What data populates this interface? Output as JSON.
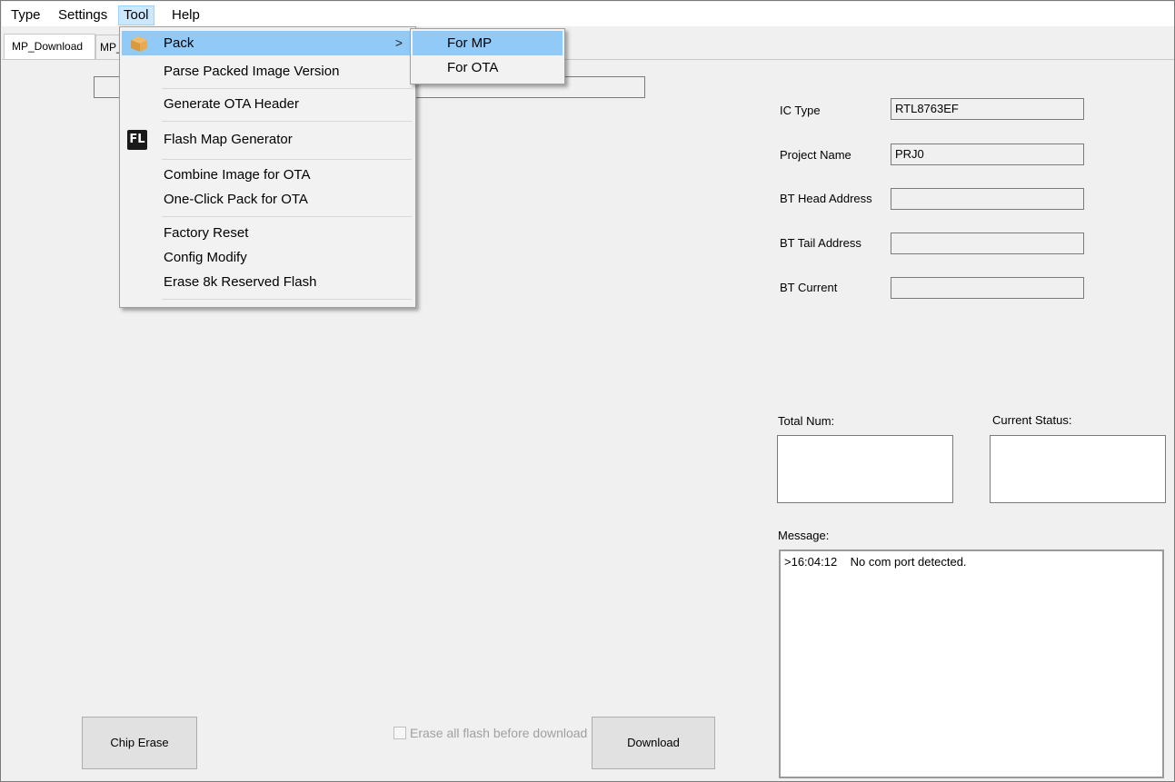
{
  "menubar": {
    "items": [
      "Type",
      "Settings",
      "Tool",
      "Help"
    ]
  },
  "tabs": [
    "MP_Download",
    "MP_"
  ],
  "tool_menu": {
    "items": [
      {
        "label": "Pack",
        "has_submenu": true
      },
      {
        "label": "Parse Packed Image Version"
      },
      {
        "label": "Generate OTA Header"
      },
      {
        "label": "Flash Map Generator"
      },
      {
        "label": "Combine Image for OTA"
      },
      {
        "label": "One-Click Pack for OTA"
      },
      {
        "label": "Factory Reset"
      },
      {
        "label": "Config Modify"
      },
      {
        "label": "Erase 8k Reserved Flash"
      }
    ],
    "arrow": ">",
    "fl_icon_text": "FL"
  },
  "pack_submenu": {
    "items": [
      "For MP",
      "For OTA"
    ]
  },
  "info": {
    "ic_type_label": "IC Type",
    "ic_type_value": "RTL8763EF",
    "project_name_label": "Project Name",
    "project_name_value": "PRJ0",
    "bt_head_label": "BT Head Address",
    "bt_head_value": "",
    "bt_tail_label": "BT Tail Address",
    "bt_tail_value": "",
    "bt_current_label": "BT Current",
    "bt_current_value": ""
  },
  "status": {
    "total_num_label": "Total Num:",
    "current_status_label": "Current Status:",
    "message_label": "Message:",
    "message_text": ">16:04:12    No com port detected."
  },
  "buttons": {
    "chip_erase": "Chip Erase",
    "download": "Download",
    "erase_all_label": "Erase all flash before download"
  },
  "icons": {
    "pack": "package-icon",
    "flash_map": "fl-icon",
    "submenu_arrow": "chevron-right-icon"
  },
  "colors": {
    "menu_highlight": "#91c9f7",
    "menubar_active": "#cce8ff",
    "package_icon": "#e0a040"
  }
}
